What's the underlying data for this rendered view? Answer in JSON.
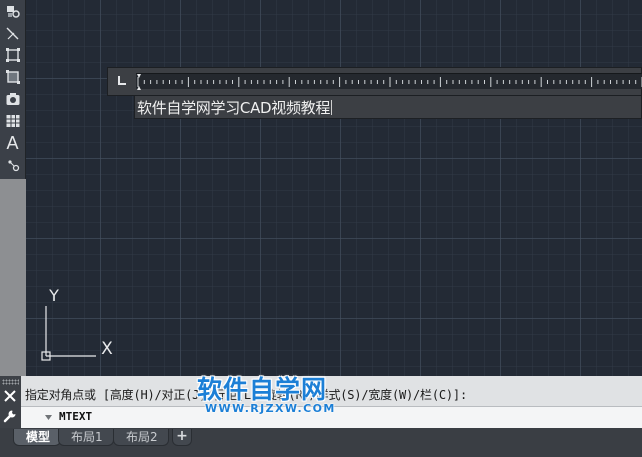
{
  "editor": {
    "mtext_content": "软件自学网学习CAD视频教程"
  },
  "ucs": {
    "y_label": "Y",
    "x_label": "X"
  },
  "command": {
    "history_prompt": "指定对角点或 [高度(H)/对正(J)/行距(L)/旋转(R)/样式(S)/宽度(W)/栏(C)]:",
    "current_command": "MTEXT"
  },
  "watermark": {
    "title": "软件自学网",
    "url": "WWW.RJZXW.COM"
  },
  "tabs": [
    {
      "label": "模型",
      "active": true
    },
    {
      "label": "布局1",
      "active": false
    },
    {
      "label": "布局2",
      "active": false
    }
  ],
  "tabs_add_label": "+",
  "toolbar": {
    "text_tool_glyph": "A",
    "icons": [
      "block-icon",
      "line-icon",
      "region-icon",
      "boundary-icon",
      "camera-icon",
      "table-icon",
      "text-icon",
      "point-icon"
    ]
  },
  "colors": {
    "canvas_bg": "#232a35",
    "watermark_blue": "#1c7fd6"
  }
}
